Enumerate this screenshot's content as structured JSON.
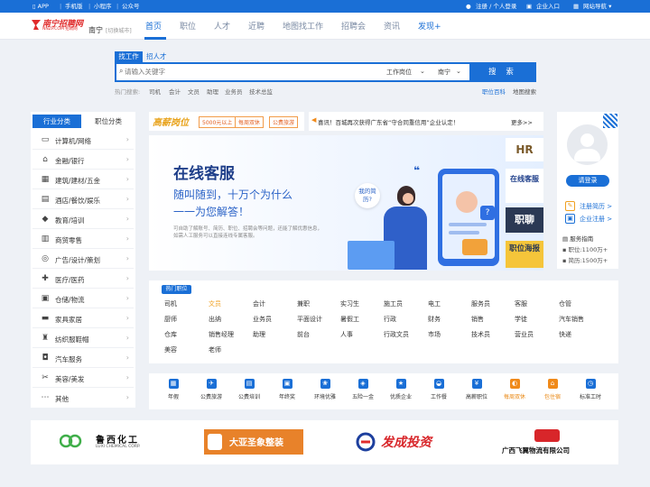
{
  "topbar": {
    "app": "APP",
    "mobile": "手机版",
    "miniprogram": "小程序",
    "official": "公众号",
    "login": "注册 / 个人登录",
    "enterprise": "企业入口",
    "site_nav": "网站导航"
  },
  "header": {
    "logo_text": "南宁招聘网",
    "logo_sub": "NNZP.COM 招聘网",
    "city": "南宁",
    "city_switch": "[切换城市]",
    "nav": [
      "首页",
      "职位",
      "人才",
      "近聘",
      "地图找工作",
      "招聘会",
      "资讯",
      "发现+"
    ]
  },
  "search": {
    "tab_job": "找工作",
    "tab_talent": "招人才",
    "placeholder": "请输入关键字",
    "type_select": "工作岗位",
    "area_select": "南宁",
    "button": "搜 索",
    "hot_label": "热门搜索:",
    "hot_keywords": [
      "司机",
      "会计",
      "文员",
      "助理",
      "业务员",
      "技术总监"
    ],
    "links": [
      "职位百科",
      "地图搜索"
    ]
  },
  "category": {
    "tabs": [
      "行业分类",
      "职位分类"
    ],
    "items": [
      {
        "label": "计算机/网络",
        "icon": "monitor-icon"
      },
      {
        "label": "金融/银行",
        "icon": "bank-icon"
      },
      {
        "label": "建筑/建材/五金",
        "icon": "building-icon"
      },
      {
        "label": "酒店/餐饮/娱乐",
        "icon": "hotel-icon"
      },
      {
        "label": "教育/培训",
        "icon": "graduation-icon"
      },
      {
        "label": "商贸零售",
        "icon": "store-icon"
      },
      {
        "label": "广告/设计/策划",
        "icon": "ad-icon"
      },
      {
        "label": "医疗/医药",
        "icon": "medical-icon"
      },
      {
        "label": "仓储/物流",
        "icon": "truck-icon"
      },
      {
        "label": "家具家居",
        "icon": "sofa-icon"
      },
      {
        "label": "纺织服鞋帽",
        "icon": "shirt-icon"
      },
      {
        "label": "汽车服务",
        "icon": "car-icon"
      },
      {
        "label": "美容/美发",
        "icon": "beauty-icon"
      },
      {
        "label": "其他",
        "icon": "more-icon"
      }
    ]
  },
  "promo": {
    "title": "高薪岗位",
    "tags": [
      "5000元以上",
      "每周双休",
      "公费旅游"
    ]
  },
  "notice": {
    "text": "喜讯！百城再次获得广东省“守合同重信用”企业认定！",
    "more": "更多>>"
  },
  "banner": {
    "title": "在线客服",
    "line1": "随叫随到，十万个为什么",
    "line2": "一一为您解答！",
    "desc": "可自助了解账号、简历、职位、招聘会等问题，还能了解优惠信息，如需人工服务可以直接连线专属客服。",
    "bubble": "我的简历?",
    "side_cards": [
      "HR",
      "在线客服",
      "职聊",
      "职位海报"
    ]
  },
  "user": {
    "login_button": "请登录",
    "register_resume": "注册简历 >",
    "enterprise_register": "企业注册 >",
    "service_guide": "服务指南",
    "job_count": "职位:1100万+",
    "resume_count": "简历:1500万+"
  },
  "hot_jobs": {
    "title": "热门职位",
    "rows": [
      [
        "司机",
        "文员",
        "会计",
        "兼职",
        "实习生",
        "施工员",
        "电工",
        "服务员",
        "客服",
        "仓管"
      ],
      [
        "厨师",
        "出纳",
        "业务员",
        "平面设计",
        "暑假工",
        "行政",
        "财务",
        "销售",
        "学徒",
        "汽车销售"
      ],
      [
        "仓库",
        "销售经理",
        "助理",
        "前台",
        "人事",
        "行政文员",
        "市场",
        "技术员",
        "营业员",
        "快递"
      ],
      [
        "美容",
        "老师"
      ]
    ]
  },
  "services": [
    {
      "label": "年假",
      "icon": "calendar-icon"
    },
    {
      "label": "公费旅游",
      "icon": "travel-icon"
    },
    {
      "label": "公费培训",
      "icon": "training-icon"
    },
    {
      "label": "年终奖",
      "icon": "bonus-icon"
    },
    {
      "label": "环境优雅",
      "icon": "environment-icon"
    },
    {
      "label": "五险一金",
      "icon": "shield-icon"
    },
    {
      "label": "优质企业",
      "icon": "star-icon"
    },
    {
      "label": "工作餐",
      "icon": "meal-icon"
    },
    {
      "label": "高薪职位",
      "icon": "money-icon"
    },
    {
      "label": "每周双休",
      "icon": "weekend-icon"
    },
    {
      "label": "包住宿",
      "icon": "house-icon"
    },
    {
      "label": "标准工时",
      "icon": "clock-icon"
    }
  ],
  "brands": [
    "鲁西化工",
    "LUXI CHEMICAL CORP.",
    "大亚圣象整装",
    "发成投资",
    "广西飞翼物流有限公司"
  ],
  "colors": {
    "primary": "#1a6fd6",
    "accent": "#f08a1a",
    "red": "#e02c2c"
  }
}
